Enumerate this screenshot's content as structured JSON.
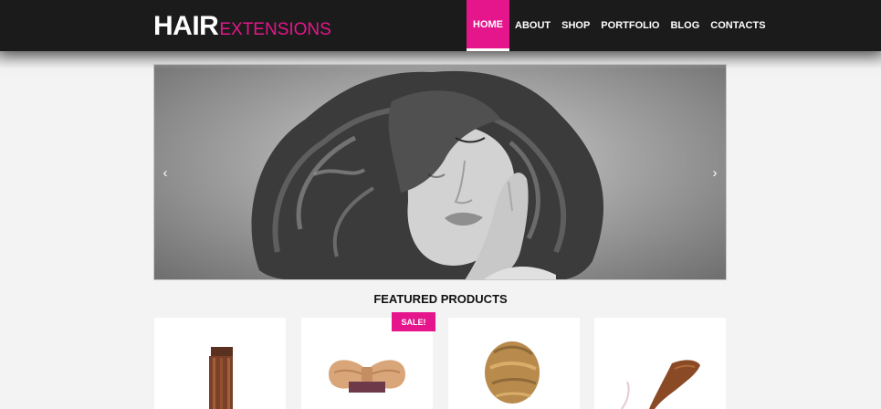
{
  "brand": {
    "main": "HAIR",
    "sub": "EXTENSIONS"
  },
  "nav": {
    "items": [
      {
        "label": "HOME",
        "active": true
      },
      {
        "label": "ABOUT",
        "active": false
      },
      {
        "label": "SHOP",
        "active": false
      },
      {
        "label": "PORTFOLIO",
        "active": false
      },
      {
        "label": "BLOG",
        "active": false
      },
      {
        "label": "CONTACTS",
        "active": false
      }
    ]
  },
  "slider": {
    "prev_icon": "chevron-left-icon",
    "next_icon": "chevron-right-icon",
    "prev_glyph": "‹",
    "next_glyph": "›"
  },
  "featured": {
    "title": "FEATURED PRODUCTS",
    "sale_label": "SALE!"
  },
  "colors": {
    "accent": "#e5168c",
    "header_bg": "#1b1b1b",
    "page_bg": "#f3f3f3"
  }
}
